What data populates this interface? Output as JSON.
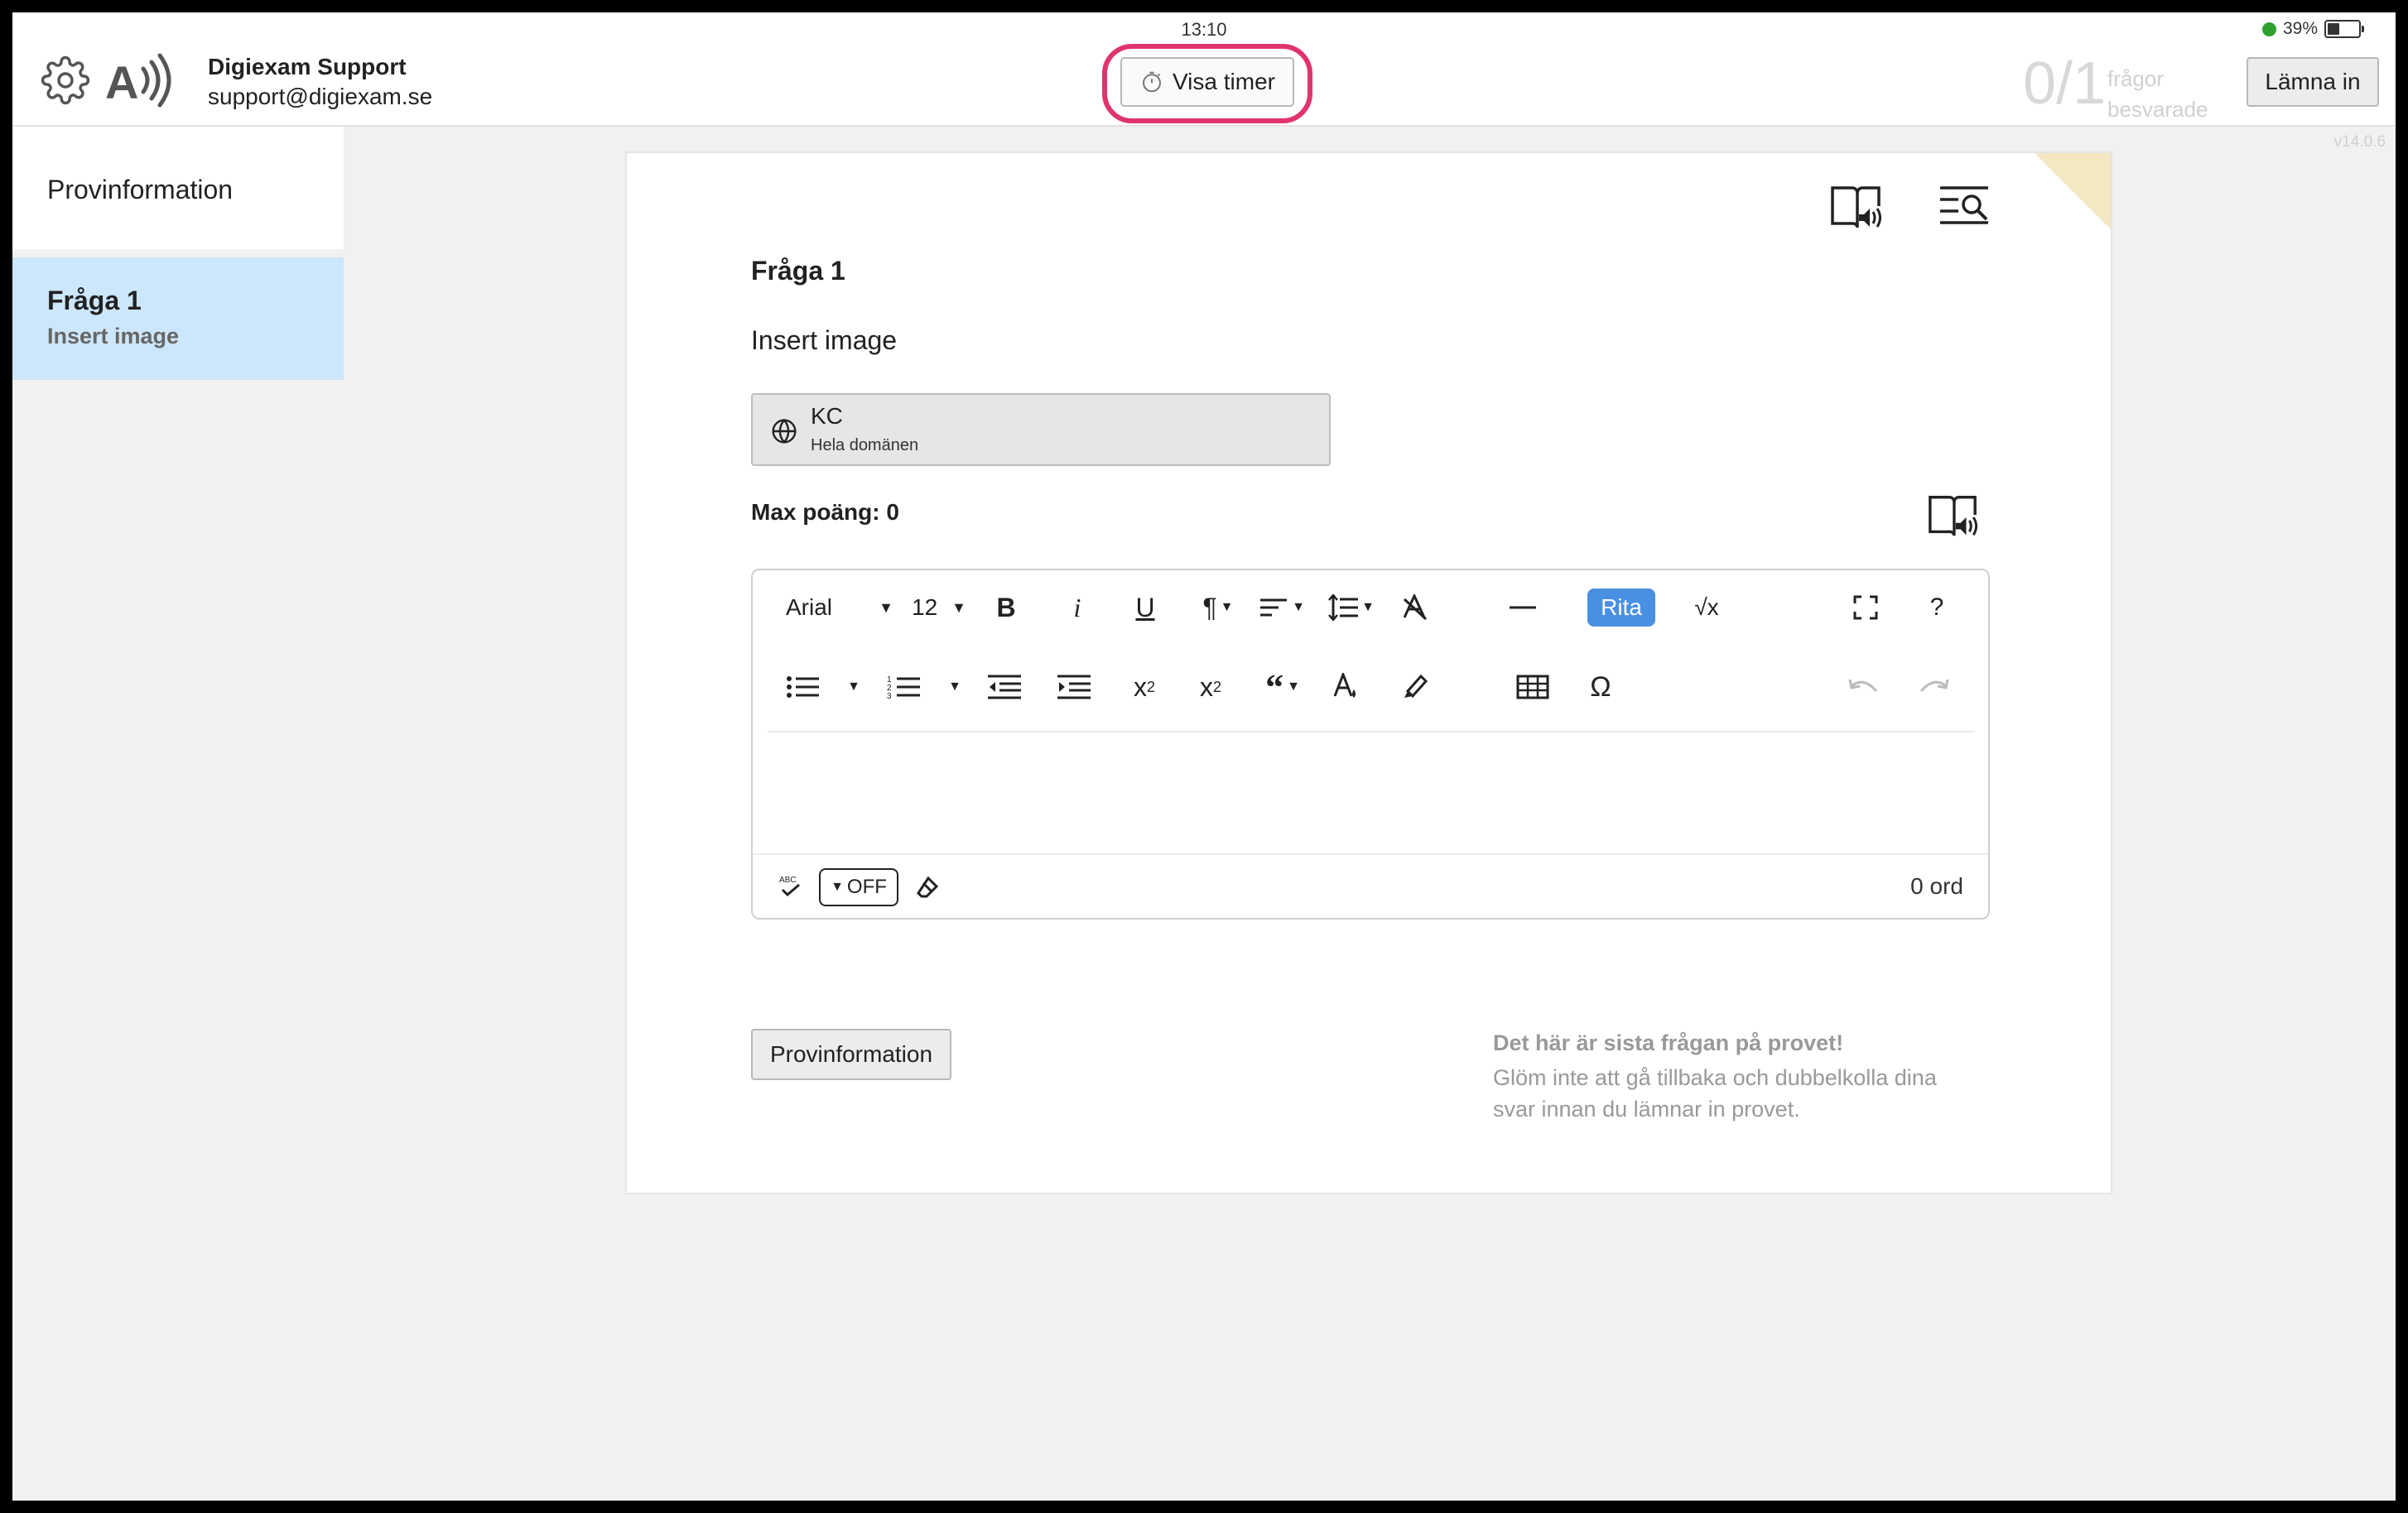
{
  "status_bar": {
    "time": "13:10",
    "battery": "39%"
  },
  "header": {
    "user_name": "Digiexam Support",
    "user_email": "support@digiexam.se",
    "timer_button": "Visa timer",
    "progress_count": "0/1",
    "progress_label_line1": "frågor",
    "progress_label_line2": "besvarade",
    "submit_button": "Lämna in",
    "version": "v14.0.6"
  },
  "sidebar": {
    "items": [
      {
        "label": "Provinformation"
      },
      {
        "title": "Fråga 1",
        "subtitle": "Insert image"
      }
    ]
  },
  "question": {
    "title": "Fråga 1",
    "text": "Insert image",
    "kc_title": "KC",
    "kc_subtitle": "Hela domänen",
    "max_points": "Max poäng: 0"
  },
  "editor": {
    "font": "Arial",
    "font_size": "12",
    "rita": "Rita",
    "spellcheck_toggle": "OFF",
    "word_count": "0 ord"
  },
  "footer": {
    "prov_button": "Provinformation",
    "last_question_title": "Det här är sista frågan på provet!",
    "last_question_text": "Glöm inte att gå tillbaka och dubbelkolla dina svar innan du lämnar in provet."
  },
  "colors": {
    "highlight": "#e0346f",
    "accent": "#4a90e2",
    "selected": "#cce6fb"
  }
}
